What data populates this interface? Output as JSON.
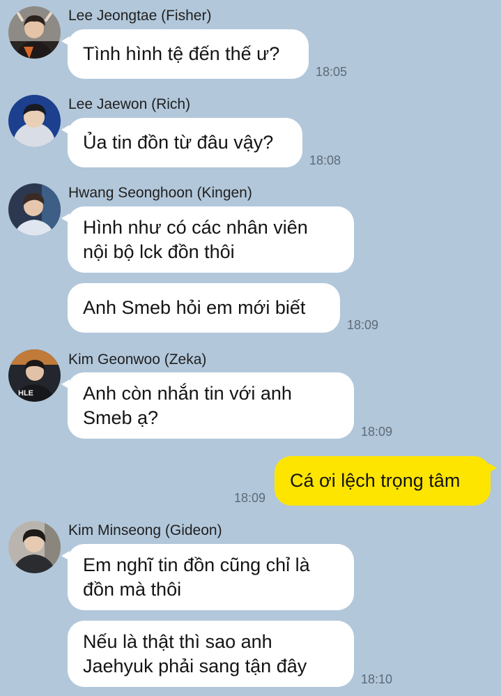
{
  "messages": [
    {
      "sender": "Lee Jeongtae (Fisher)",
      "lines": [
        "Tình hình tệ đến thế ư?"
      ],
      "time": "18:05"
    },
    {
      "sender": "Lee Jaewon (Rich)",
      "lines": [
        "Ủa tin đồn từ đâu vậy?"
      ],
      "time": "18:08"
    },
    {
      "sender": "Hwang Seonghoon (Kingen)",
      "lines": [
        "Hình như có các nhân viên",
        "nội bộ lck đồn thôi"
      ],
      "time": ""
    },
    {
      "sender": "",
      "lines": [
        "Anh Smeb hỏi em mới biết"
      ],
      "time": "18:09"
    },
    {
      "sender": "Kim Geonwoo (Zeka)",
      "lines": [
        "Anh còn nhắn tin với anh",
        "Smeb ạ?"
      ],
      "time": "18:09"
    },
    {
      "sender": "",
      "lines": [
        "Cá ơi lệch trọng tâm"
      ],
      "time": "18:09",
      "mine": true
    },
    {
      "sender": "Kim Minseong (Gideon)",
      "lines": [
        "Em nghĩ tin đồn cũng chỉ là",
        "đồn mà thôi"
      ],
      "time": ""
    },
    {
      "sender": "",
      "lines": [
        "Nếu là thật thì sao anh",
        "Jaehyuk phải sang tận đây"
      ],
      "time": "18:10"
    }
  ],
  "icons": {
    "avatar": "user-avatar-photo"
  },
  "colors": {
    "background": "#b2c7da",
    "incoming_bubble": "#ffffff",
    "outgoing_bubble": "#fee500",
    "timestamp": "#5d6a77"
  }
}
